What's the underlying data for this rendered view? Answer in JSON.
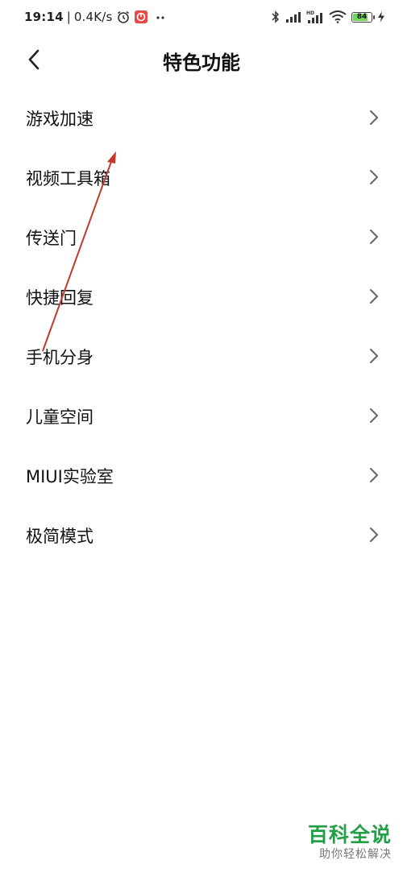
{
  "status_bar": {
    "time": "19:14",
    "separator": "|",
    "net_speed": "0.4K/s",
    "battery_level": "84",
    "battery_fill_fraction": 0.84,
    "icons": [
      "alarm-icon",
      "app-notification-icon",
      "more-dots-icon",
      "bluetooth-icon",
      "signal-icon",
      "hd-signal-icon",
      "wifi-icon",
      "battery-icon",
      "charging-icon"
    ],
    "accent_color": "#74d65a"
  },
  "header": {
    "title": "特色功能",
    "back_icon": "chevron-left-icon"
  },
  "menu": {
    "items": [
      {
        "label": "游戏加速"
      },
      {
        "label": "视频工具箱"
      },
      {
        "label": "传送门"
      },
      {
        "label": "快捷回复"
      },
      {
        "label": "手机分身"
      },
      {
        "label": "儿童空间"
      },
      {
        "label": "MIUI实验室"
      },
      {
        "label": "极简模式"
      }
    ],
    "item_icon": "chevron-right-icon"
  },
  "annotation": {
    "color": "#c0392b",
    "icon": "arrow-annotation-icon"
  },
  "watermark": {
    "brand": "百科全说",
    "slogan": "助你轻松解决",
    "brand_color": "#23a047"
  }
}
